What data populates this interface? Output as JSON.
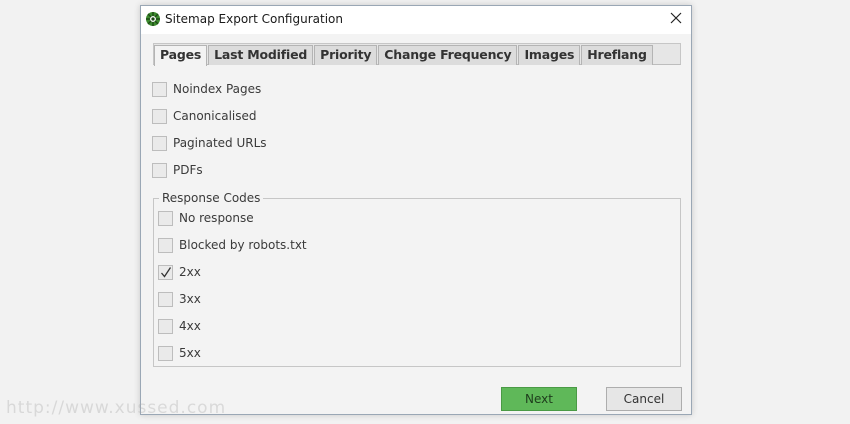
{
  "window": {
    "title": "Sitemap Export Configuration"
  },
  "tabs": [
    {
      "label": "Pages",
      "active": true
    },
    {
      "label": "Last Modified",
      "active": false
    },
    {
      "label": "Priority",
      "active": false
    },
    {
      "label": "Change Frequency",
      "active": false
    },
    {
      "label": "Images",
      "active": false
    },
    {
      "label": "Hreflang",
      "active": false
    }
  ],
  "page_options": [
    {
      "label": "Noindex Pages",
      "checked": false
    },
    {
      "label": "Canonicalised",
      "checked": false
    },
    {
      "label": "Paginated URLs",
      "checked": false
    },
    {
      "label": "PDFs",
      "checked": false
    }
  ],
  "response_codes": {
    "label": "Response Codes",
    "items": [
      {
        "label": "No response",
        "checked": false
      },
      {
        "label": "Blocked by robots.txt",
        "checked": false
      },
      {
        "label": "2xx",
        "checked": true
      },
      {
        "label": "3xx",
        "checked": false
      },
      {
        "label": "4xx",
        "checked": false
      },
      {
        "label": "5xx",
        "checked": false
      }
    ]
  },
  "buttons": {
    "next_label": "Next",
    "cancel_label": "Cancel"
  },
  "watermark": "http://www.xussed.com",
  "colors": {
    "next_button": "#5fb859",
    "app_icon": "#3c8a2e"
  }
}
